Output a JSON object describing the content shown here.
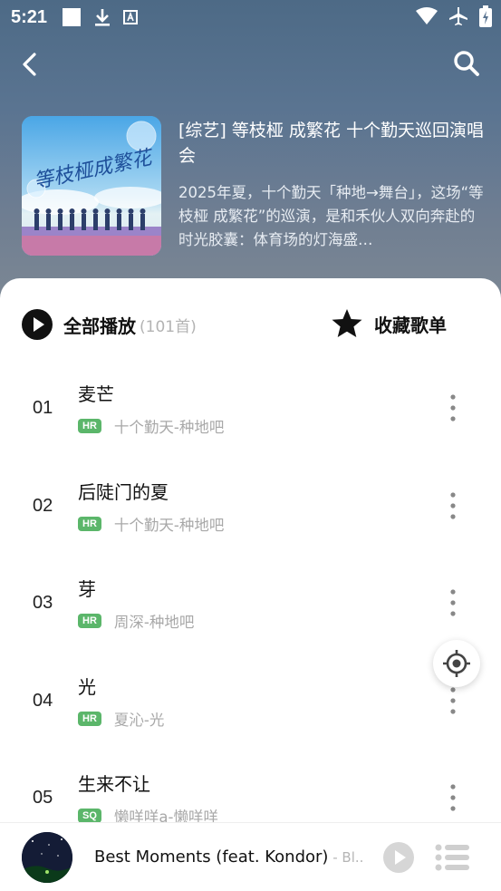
{
  "status": {
    "time": "5:21"
  },
  "album": {
    "title": "[综艺] 等枝桠 成繁花 十个勤天巡回演唱会",
    "description": "2025年夏，十个勤天「种地→舞台」，这场“等枝桠 成繁花”的巡演，是和禾伙人双向奔赴的时光胶囊：体育场的灯海盛…",
    "cover_text": "等枝桠成繁花"
  },
  "actions": {
    "play_all_label": "全部播放",
    "play_all_count": "(101首)",
    "collect_label": "收藏歌单"
  },
  "songs": [
    {
      "num": "01",
      "title": "麦芒",
      "badge": "HR",
      "artist": "十个勤天-种地吧"
    },
    {
      "num": "02",
      "title": "后陡门的夏",
      "badge": "HR",
      "artist": "十个勤天-种地吧"
    },
    {
      "num": "03",
      "title": "芽",
      "badge": "HR",
      "artist": "周深-种地吧"
    },
    {
      "num": "04",
      "title": "光",
      "badge": "HR",
      "artist": "夏沁-光"
    },
    {
      "num": "05",
      "title": "生来不让",
      "badge": "SQ",
      "artist": "懒咩咩a-懒咩咩"
    }
  ],
  "badge_colors": {
    "HR": "#5bb66a",
    "SQ": "#5bb66a"
  },
  "player": {
    "song": "Best Moments (feat. Kondor)",
    "artist": " - Bl..."
  },
  "icons": {
    "back": "chevron-left-icon",
    "search": "search-icon",
    "play_all": "play-circle-icon",
    "collect": "star-icon",
    "more": "more-vertical-icon",
    "locate": "locate-icon",
    "play": "play-icon",
    "queue": "playlist-icon"
  }
}
